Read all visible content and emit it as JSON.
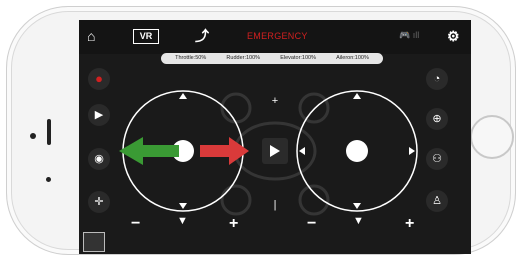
{
  "topbar": {
    "home_icon": "home-icon",
    "vr_label": "VR",
    "emergency_label": "EMERGENCY",
    "settings_icon": "gear-icon"
  },
  "status": {
    "throttle": "Throttle:50%",
    "rudder": "Rudder:100%",
    "elevator": "Elevator:100%",
    "aileron": "Aileron:100%"
  },
  "controls": {
    "center_play_icon": "play-icon",
    "left_sidebar": [
      "record-dot-icon",
      "video-camera-icon",
      "camera-icon",
      "gyro-icon"
    ],
    "right_sidebar": [
      "speedometer-icon",
      "headless-icon",
      "drone-icon",
      "landing-icon"
    ],
    "plus": "+",
    "minus": "−",
    "arrow_down": "▼"
  },
  "colors": {
    "emergency": "#d12020",
    "arrow_green": "#3a9a34",
    "arrow_red": "#d93a3a"
  }
}
